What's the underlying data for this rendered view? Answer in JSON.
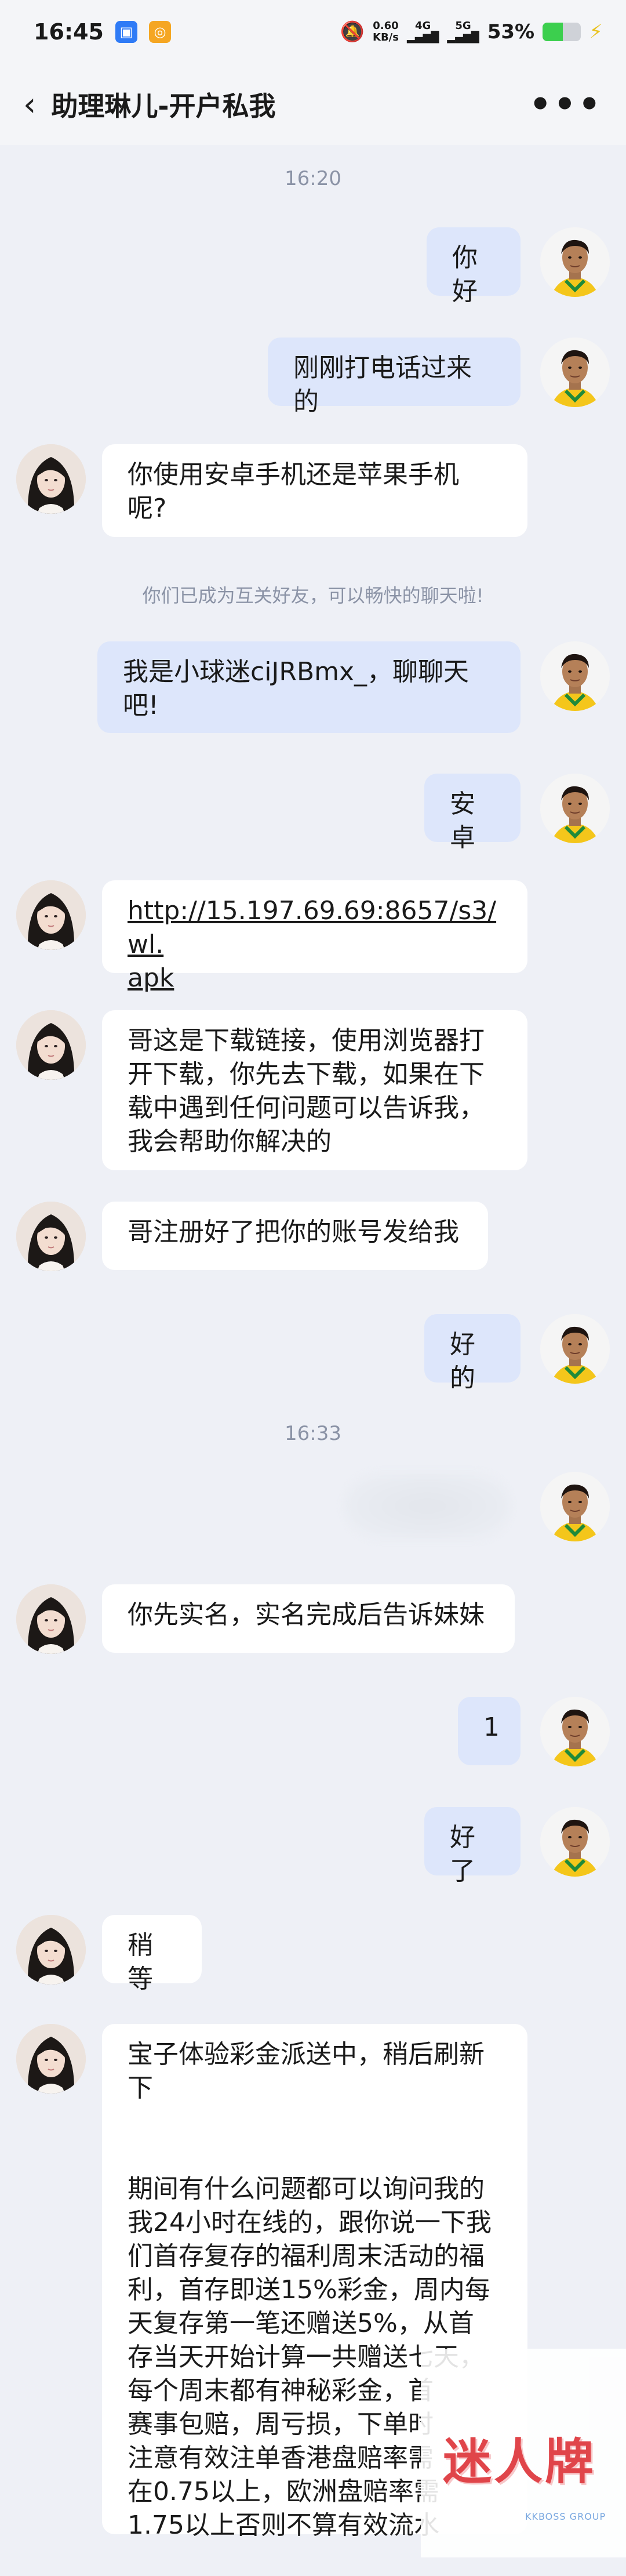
{
  "status_bar": {
    "time": "16:45",
    "net_speed_value": "0.60",
    "net_speed_unit": "KB/s",
    "net_type_1": "4G",
    "net_type_2": "5G",
    "battery_text": "53%",
    "battery_level": 0.53,
    "app_icon_colors": [
      "#2f7bf6",
      "#f5a623"
    ]
  },
  "header": {
    "title": "助理琳儿-开户私我",
    "more_icon": "more-icon",
    "back_icon": "back-icon"
  },
  "messages": {
    "time_1": "16:20",
    "m1": "你好",
    "m2": "刚刚打电话过来的",
    "m3": "你使用安卓手机还是苹果手机\n呢?",
    "notice": "你们已成为互关好友，可以畅快的聊天啦!",
    "m4": "我是小球迷ciJRBmx_，聊聊天\n吧!",
    "m5": "安卓",
    "m6": "http://15.197.69.69:8657/s3/wl.\napk",
    "m7": "哥这是下载链接，使用浏览器打\n开下载，你先去下载，如果在下\n载中遇到任何问题可以告诉我，\n我会帮助你解决的",
    "m8": "哥注册好了把你的账号发给我",
    "m9": "好的",
    "time_2": "16:33",
    "m10": "你先实名，实名完成后告诉妹妹",
    "m11": "1",
    "m12": "好了",
    "m13": "稍等",
    "m14": "宝子体验彩金派送中，稍后刷新\n下\n\n\n期间有什么问题都可以询问我的\n我24小时在线的，跟你说一下我\n们首存复存的福利周末活动的福\n利，首存即送15%彩金，周内每\n天复存第一笔还赠送5%，从首\n存当天开始计算一共赠送七天，\n每个周末都有神秘彩金，首\n赛事包赔，周亏损，下单时\n注意有效注单香港盘赔率需\n在0.75以上，欧洲盘赔率需\n1.75以上否则不算有效流水"
  },
  "watermark": {
    "text": "迷人牌",
    "tag": "KKBOSS GROUP"
  },
  "colors": {
    "background": "#eef0f6",
    "outgoing_bubble": "#dde6fb",
    "incoming_bubble": "#ffffff",
    "system_text": "#8b93a6"
  }
}
